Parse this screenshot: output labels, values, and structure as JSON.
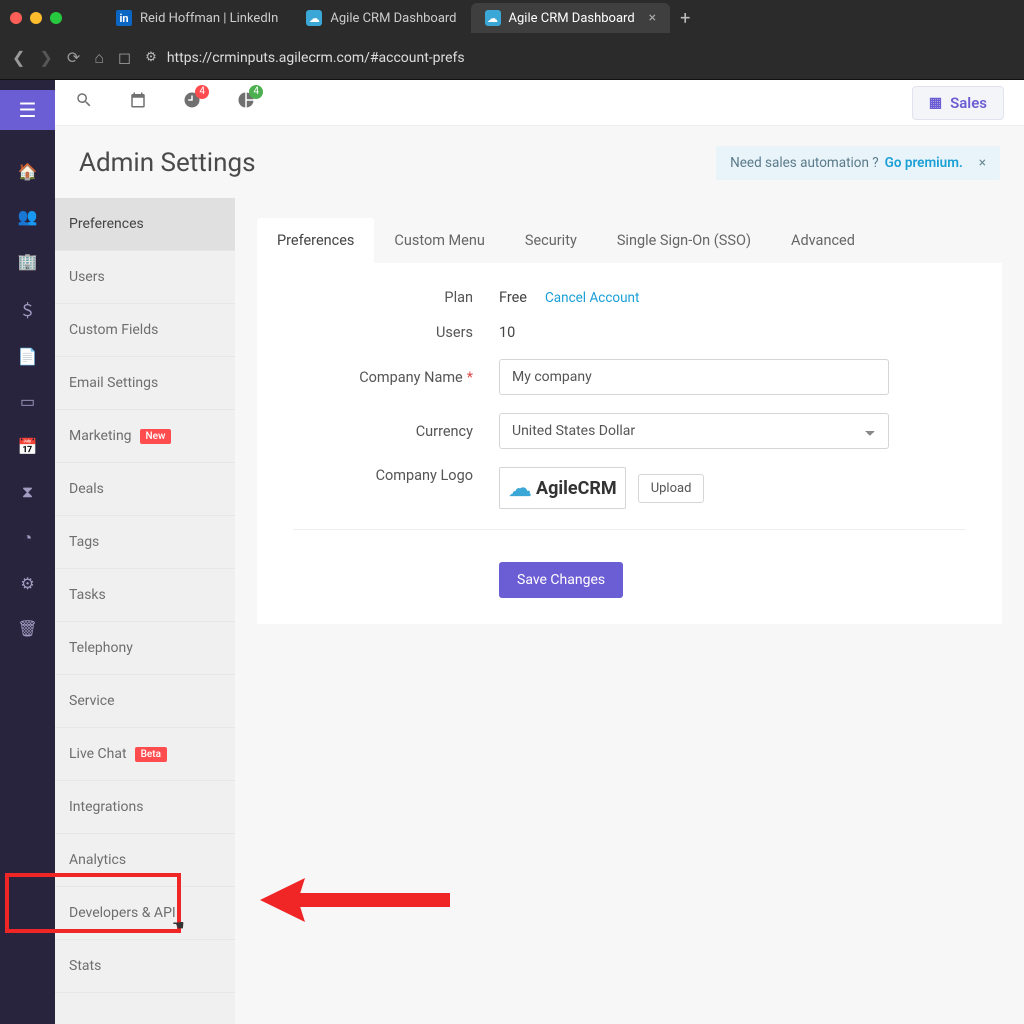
{
  "browser": {
    "tabs": [
      {
        "label": "Reid Hoffman | LinkedIn",
        "icon": "linkedin"
      },
      {
        "label": "Agile CRM Dashboard",
        "icon": "cloud"
      },
      {
        "label": "Agile CRM Dashboard",
        "icon": "cloud",
        "active": true
      }
    ],
    "url": "https://crminputs.agilecrm.com/#account-prefs"
  },
  "topbar": {
    "notif_count": "4",
    "chart_count": "4",
    "sales_label": "Sales"
  },
  "header": {
    "title": "Admin Settings",
    "premium_text": "Need sales automation ? ",
    "premium_link": "Go premium."
  },
  "sidebar": {
    "items": [
      {
        "label": "Preferences",
        "active": true
      },
      {
        "label": "Users"
      },
      {
        "label": "Custom Fields"
      },
      {
        "label": "Email Settings"
      },
      {
        "label": "Marketing",
        "badge": "New"
      },
      {
        "label": "Deals"
      },
      {
        "label": "Tags"
      },
      {
        "label": "Tasks"
      },
      {
        "label": "Telephony"
      },
      {
        "label": "Service"
      },
      {
        "label": "Live Chat",
        "badge": "Beta"
      },
      {
        "label": "Integrations"
      },
      {
        "label": "Analytics"
      },
      {
        "label": "Developers & API"
      },
      {
        "label": "Stats"
      }
    ]
  },
  "tabs": {
    "items": [
      "Preferences",
      "Custom Menu",
      "Security",
      "Single Sign-On (SSO)",
      "Advanced"
    ],
    "active": 0
  },
  "form": {
    "plan_label": "Plan",
    "plan_value": "Free",
    "cancel_link": "Cancel Account",
    "users_label": "Users",
    "users_value": "10",
    "company_label": "Company Name",
    "company_value": "My company",
    "currency_label": "Currency",
    "currency_value": "United States Dollar",
    "logo_label": "Company Logo",
    "logo_text": "AgileCRM",
    "upload_label": "Upload",
    "save_label": "Save Changes"
  }
}
